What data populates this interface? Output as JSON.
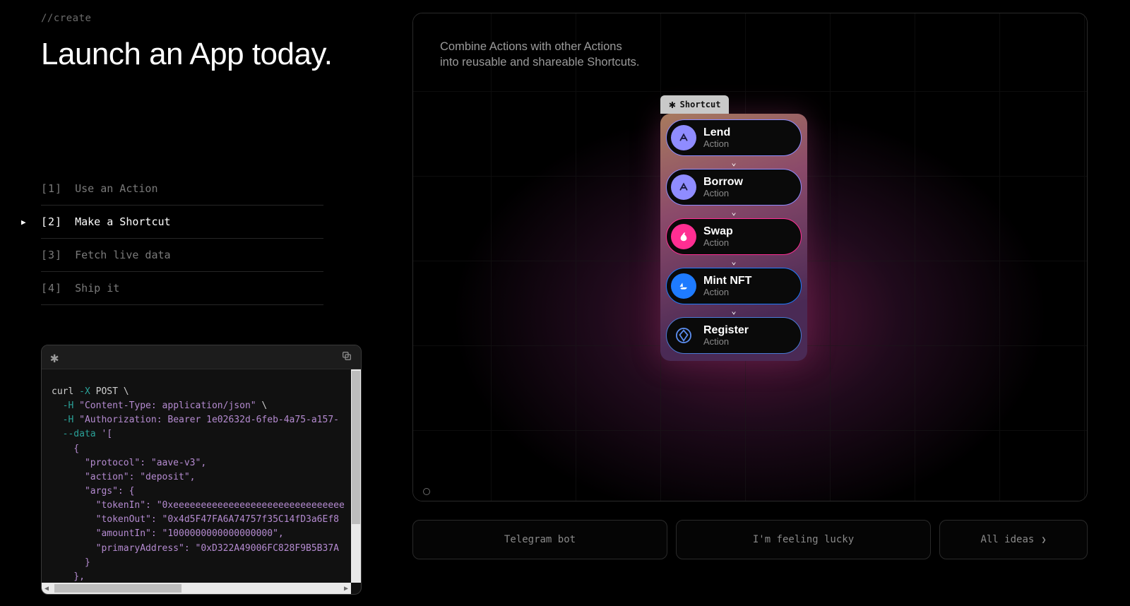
{
  "eyebrow": "//create",
  "headline": "Launch an App today.",
  "steps": [
    {
      "num": "[1]",
      "label": "Use an Action"
    },
    {
      "num": "[2]",
      "label": "Make a Shortcut"
    },
    {
      "num": "[3]",
      "label": "Fetch live data"
    },
    {
      "num": "[4]",
      "label": "Ship it"
    }
  ],
  "activeStep": 1,
  "code": {
    "tokens": [
      {
        "cls": "tok-cmd",
        "t": "curl "
      },
      {
        "cls": "tok-flag",
        "t": "-X"
      },
      {
        "cls": "tok-cmd",
        "t": " POST \\"
      },
      {
        "br": true
      },
      {
        "cls": "tok-cmd",
        "t": "  "
      },
      {
        "cls": "tok-flag",
        "t": "-H "
      },
      {
        "cls": "tok-str",
        "t": "\"Content-Type: application/json\""
      },
      {
        "cls": "tok-cmd",
        "t": " \\"
      },
      {
        "br": true
      },
      {
        "cls": "tok-cmd",
        "t": "  "
      },
      {
        "cls": "tok-flag",
        "t": "-H "
      },
      {
        "cls": "tok-str",
        "t": "\"Authorization: Bearer 1e02632d-6feb-4a75-a157-"
      },
      {
        "br": true
      },
      {
        "cls": "tok-cmd",
        "t": "  "
      },
      {
        "cls": "tok-flag",
        "t": "--data "
      },
      {
        "cls": "tok-str",
        "t": "'["
      },
      {
        "br": true
      },
      {
        "cls": "tok-str",
        "t": "    {"
      },
      {
        "br": true
      },
      {
        "cls": "tok-str",
        "t": "      \"protocol\": \"aave-v3\","
      },
      {
        "br": true
      },
      {
        "cls": "tok-str",
        "t": "      \"action\": \"deposit\","
      },
      {
        "br": true
      },
      {
        "cls": "tok-str",
        "t": "      \"args\": {"
      },
      {
        "br": true
      },
      {
        "cls": "tok-str",
        "t": "        \"tokenIn\": \"0xeeeeeeeeeeeeeeeeeeeeeeeeeeeeeee"
      },
      {
        "br": true
      },
      {
        "cls": "tok-str",
        "t": "        \"tokenOut\": \"0x4d5F47FA6A74757f35C14fD3a6Ef8"
      },
      {
        "br": true
      },
      {
        "cls": "tok-str",
        "t": "        \"amountIn\": \"1000000000000000000\","
      },
      {
        "br": true
      },
      {
        "cls": "tok-str",
        "t": "        \"primaryAddress\": \"0xD322A49006FC828F9B5B37A"
      },
      {
        "br": true
      },
      {
        "cls": "tok-str",
        "t": "      }"
      },
      {
        "br": true
      },
      {
        "cls": "tok-str",
        "t": "    },"
      }
    ]
  },
  "rightCopy1": "Combine Actions with other Actions",
  "rightCopy2": "into reusable and shareable Shortcuts.",
  "shortcutTab": "Shortcut",
  "actions": [
    {
      "title": "Lend",
      "sub": "Action",
      "color": "#8f8cff",
      "bg": "#8f8cff",
      "icon": "aave",
      "txt": "#1a1a40"
    },
    {
      "title": "Borrow",
      "sub": "Action",
      "color": "#8f8cff",
      "bg": "#8f8cff",
      "icon": "aave",
      "txt": "#1a1a40"
    },
    {
      "title": "Swap",
      "sub": "Action",
      "color": "#ff2e92",
      "bg": "#ff2e92",
      "icon": "uniswap",
      "txt": "#fff"
    },
    {
      "title": "Mint NFT",
      "sub": "Action",
      "color": "#1e7bff",
      "bg": "#1e7bff",
      "icon": "opensea",
      "txt": "#fff"
    },
    {
      "title": "Register",
      "sub": "Action",
      "color": "#4a7bd6",
      "bg": "#0a0a0a",
      "icon": "ens",
      "txt": "#5b8dee"
    }
  ],
  "buttons": {
    "telegram": "Telegram bot",
    "lucky": "I'm feeling lucky",
    "all": "All ideas"
  }
}
